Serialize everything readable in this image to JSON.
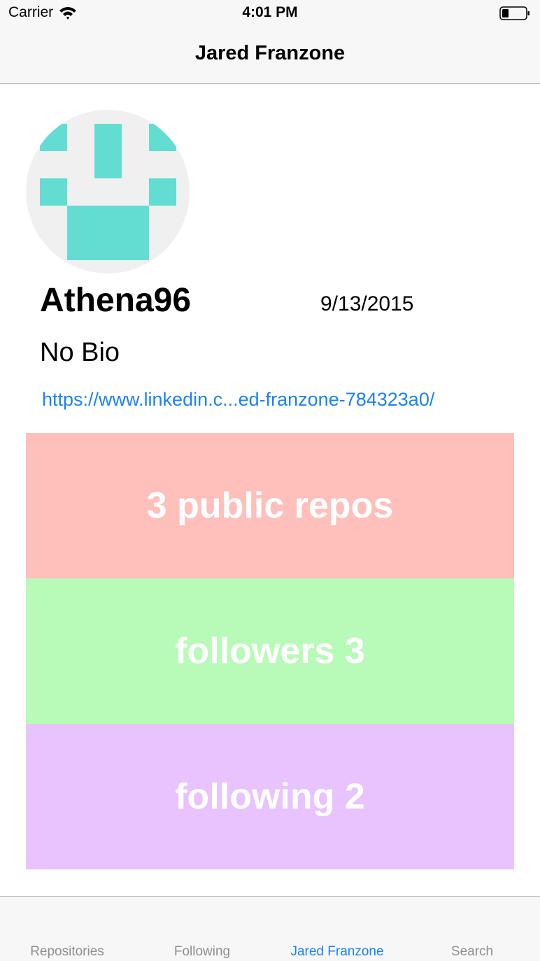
{
  "status_bar": {
    "carrier": "Carrier",
    "time": "4:01 PM",
    "icons": [
      "wifi-icon",
      "battery-icon"
    ]
  },
  "nav": {
    "title": "Jared Franzone"
  },
  "profile": {
    "avatar": "identicon",
    "username": "Athena96",
    "joined_date": "9/13/2015",
    "bio": "No Bio",
    "link": "https://www.linkedin.c...ed-franzone-784323a0/"
  },
  "stats": {
    "repos": {
      "label": "3 public repos",
      "color": "#ffbfbb"
    },
    "followers": {
      "label": "followers 3",
      "color": "#b8fbb8"
    },
    "following": {
      "label": "following 2",
      "color": "#e8c3fd"
    }
  },
  "tab_bar": {
    "items": [
      {
        "label": "Repositories",
        "active": false
      },
      {
        "label": "Following",
        "active": false
      },
      {
        "label": "Jared Franzone",
        "active": true
      },
      {
        "label": "Search",
        "active": false
      }
    ]
  },
  "colors": {
    "accent": "#1a82f6",
    "identicon": "#63ddd1",
    "bar_background": "#f7f7f7"
  }
}
